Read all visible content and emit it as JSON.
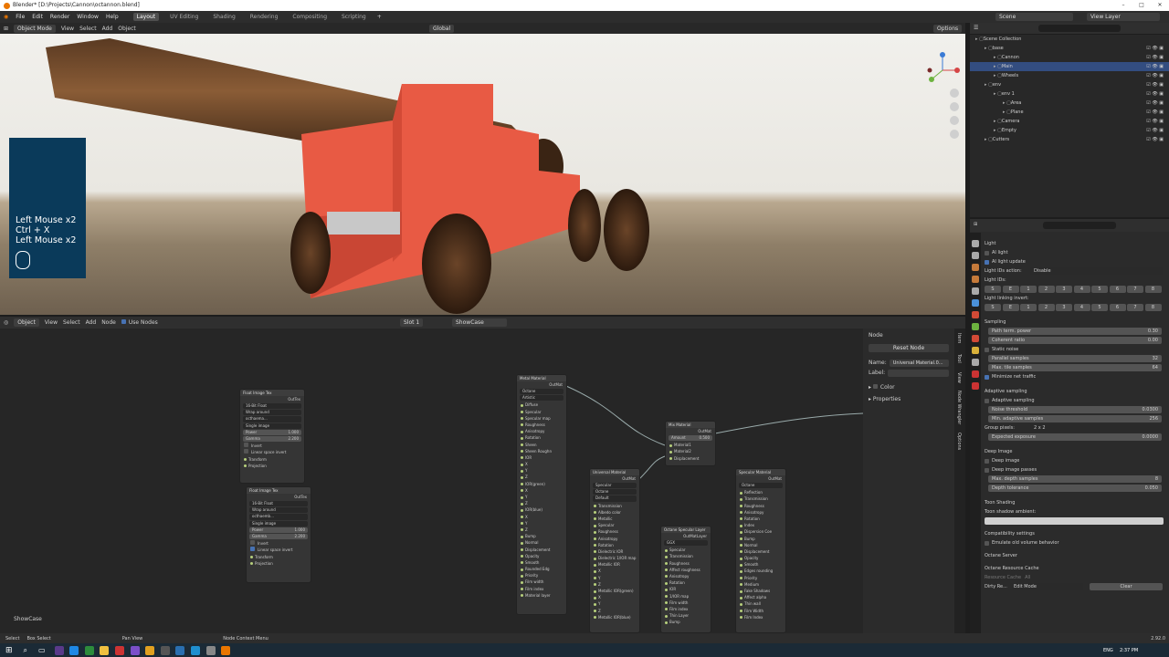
{
  "window": {
    "title": "Blender* [D:\\Projects\\Cannon\\octannon.blend]"
  },
  "menu": {
    "items": [
      "File",
      "Edit",
      "Render",
      "Window",
      "Help"
    ],
    "workspaces": [
      "Layout",
      "UV Editing",
      "Shading",
      "Rendering",
      "Compositing",
      "Scripting"
    ],
    "active_workspace": "Layout",
    "add_tab": "+",
    "scene": "Scene",
    "view_layer": "View Layer"
  },
  "viewport": {
    "mode": "Object Mode",
    "menus": [
      "View",
      "Select",
      "Add",
      "Object"
    ],
    "orientation": "Global",
    "options": "Options"
  },
  "keys_overlay": {
    "lines": [
      "Left Mouse x2",
      "Ctrl + X",
      "Left Mouse x2"
    ]
  },
  "node_header": {
    "mode": "Object",
    "menus": [
      "View",
      "Select",
      "Add",
      "Node"
    ],
    "use_nodes": "Use Nodes",
    "slot": "Slot 1",
    "material": "ShowCase"
  },
  "nodes": {
    "float1": {
      "title": "Float Image Tex",
      "out": "OutTex",
      "dd1": "16-Bit Float",
      "dd2": "Wrap around",
      "img": "octhaema...",
      "single": "Single image",
      "power_label": "Power",
      "power": "1.000",
      "gamma_label": "Gamma",
      "gamma": "2.200",
      "invert": "Invert",
      "linear": "Linear space invert",
      "transform": "Transform",
      "projection": "Projection"
    },
    "float2": {
      "title": "Float Image Tex",
      "out": "OutTex",
      "dd1": "16-Bit Float",
      "dd2": "Wrap around",
      "img": "octhaemb...",
      "single": "Single image",
      "power_label": "Power",
      "power": "1.000",
      "gamma_label": "Gamma",
      "gamma": "2.200",
      "invert": "Invert",
      "linear": "Linear space invert",
      "transform": "Transform",
      "projection": "Projection"
    },
    "metal": {
      "title": "Metal Material",
      "out": "OutMat",
      "dd1": "Octane",
      "dd2": "Artistic",
      "rows": [
        "Diffuse",
        "Specular",
        "Specular map",
        "Roughness",
        "Anisotropy",
        "Rotation",
        "Sheen",
        "Sheen Roughn",
        "IOR",
        "X",
        "Y",
        "Z",
        "IOR(green)",
        "X",
        "Y",
        "Z",
        "IOR(blue)",
        "X",
        "Y",
        "Z",
        "Bump",
        "Normal",
        "Displacement",
        "Opacity",
        "Smooth",
        "Rounded Edg",
        "Priority",
        "Film width",
        "Film index",
        "Material layer"
      ]
    },
    "mix": {
      "title": "Mix Material",
      "out": "OutMat",
      "amount_label": "Amount",
      "amount": "0.500",
      "rows": [
        "Material1",
        "Material2",
        "Displacement"
      ]
    },
    "universal": {
      "title": "Universal Material",
      "out": "OutMat",
      "dd1": "Specular",
      "dd2": "Octane",
      "dd3": "Default",
      "rows": [
        "Transmission",
        "Albedo color",
        "Metallic",
        "Specular",
        "Roughness",
        "Anisotropy",
        "Rotation",
        "Dielectric IOR",
        "Dielectric 1/IOR map",
        "Metallic IOR",
        "X",
        "Y",
        "Z",
        "Metallic IOR(green)",
        "X",
        "Y",
        "Z",
        "Metallic IOR(blue)"
      ]
    },
    "speclayer": {
      "title": "Octane Specular Layer",
      "out": "OutMatLayer",
      "dd1": "GGX",
      "rows": [
        "Specular",
        "Transmission",
        "Roughness",
        "Affect roughness",
        "Anisotropy",
        "Rotation",
        "IOR",
        "1/IOR map",
        "Film width",
        "Film index",
        "Thin Layer",
        "Bump"
      ]
    },
    "specular": {
      "title": "Specular Material",
      "out": "OutMat",
      "dd1": "Octane",
      "rows": [
        "Reflection",
        "Transmission",
        "Roughness",
        "Anisotropy",
        "Rotation",
        "Index",
        "Dispersion Coe",
        "Bump",
        "Normal",
        "Displacement",
        "Opacity",
        "Smooth",
        "Edges rounding",
        "Priority",
        "Medium",
        "Fake Shadows",
        "Affect alpha",
        "Thin wall",
        "Film Width",
        "Film Index"
      ]
    }
  },
  "node_label": "ShowCase",
  "sidebar": {
    "section": "Node",
    "reset": "Reset Node",
    "name_label": "Name:",
    "name": "Universal Material.0...",
    "label_label": "Label:",
    "color": "Color",
    "properties": "Properties",
    "tabs": [
      "Item",
      "Tool",
      "View",
      "Node Wrangler",
      "Options"
    ]
  },
  "outliner": {
    "items": [
      {
        "label": "Scene Collection",
        "indent": 0
      },
      {
        "label": "base",
        "indent": 1
      },
      {
        "label": "Cannon",
        "indent": 2
      },
      {
        "label": "Main",
        "indent": 2,
        "selected": true
      },
      {
        "label": "Wheels",
        "indent": 2
      },
      {
        "label": "env",
        "indent": 1
      },
      {
        "label": "env 1",
        "indent": 2
      },
      {
        "label": "Area",
        "indent": 3
      },
      {
        "label": "Plane",
        "indent": 3
      },
      {
        "label": "Camera",
        "indent": 2
      },
      {
        "label": "Empty",
        "indent": 2
      },
      {
        "label": "Cutters",
        "indent": 1
      }
    ]
  },
  "props": {
    "light": "Light",
    "ai_light": "AI light",
    "ai_light_update": "AI light update",
    "light_ids_action": "Light IDs action:",
    "disable": "Disable",
    "light_ids": "Light IDs:",
    "light_linking": "Light linking invert:",
    "id_buttons": [
      "S",
      "E",
      "1",
      "2",
      "3",
      "4",
      "5",
      "6",
      "7",
      "8"
    ],
    "sampling": "Sampling",
    "path_term": "Path term. power",
    "path_term_val": "0.30",
    "coherent": "Coherent ratio",
    "coherent_val": "0.00",
    "static_noise": "Static noise",
    "parallel": "Parallel samples",
    "parallel_val": "32",
    "max_tile": "Max. tile samples",
    "max_tile_val": "64",
    "minimize": "Minimize net traffic",
    "adaptive": "Adaptive sampling",
    "adaptive_chk": "Adaptive sampling",
    "noise": "Noise threshold",
    "noise_val": "0.0300",
    "min_adaptive": "Min. adaptive samples",
    "min_adaptive_val": "256",
    "group_pixels": "Group pixels:",
    "group_val": "2 x 2",
    "expected": "Expected exposure",
    "expected_val": "0.0000",
    "deep": "Deep Image",
    "deep_image": "Deep image",
    "deep_passes": "Deep image passes",
    "max_depth": "Max. depth samples",
    "max_depth_val": "8",
    "depth_tol": "Depth tolerance",
    "depth_tol_val": "0.050",
    "toon": "Toon Shading",
    "toon_ambient": "Toon shadow ambient:",
    "compat": "Compatibility settings",
    "emulate": "Emulate old volume behavior",
    "server": "Octane Server",
    "cache": "Octane Resource Cache",
    "res_cache": "Resource Cache",
    "all": "All",
    "dirty": "Dirty Re...",
    "edit_mode": "Edit Mode",
    "clear": "Clear"
  },
  "status": {
    "items": [
      "Select",
      "Box Select",
      "Pan View",
      "Node Context Menu"
    ],
    "version": "2.92.0"
  },
  "taskbar": {
    "lang": "ENG",
    "time": "2:37 PM"
  },
  "colors": {
    "accent": "#4772b3",
    "selection": "#334d80",
    "key_bg": "#0a3a5a",
    "cannon": "#e85a44"
  }
}
